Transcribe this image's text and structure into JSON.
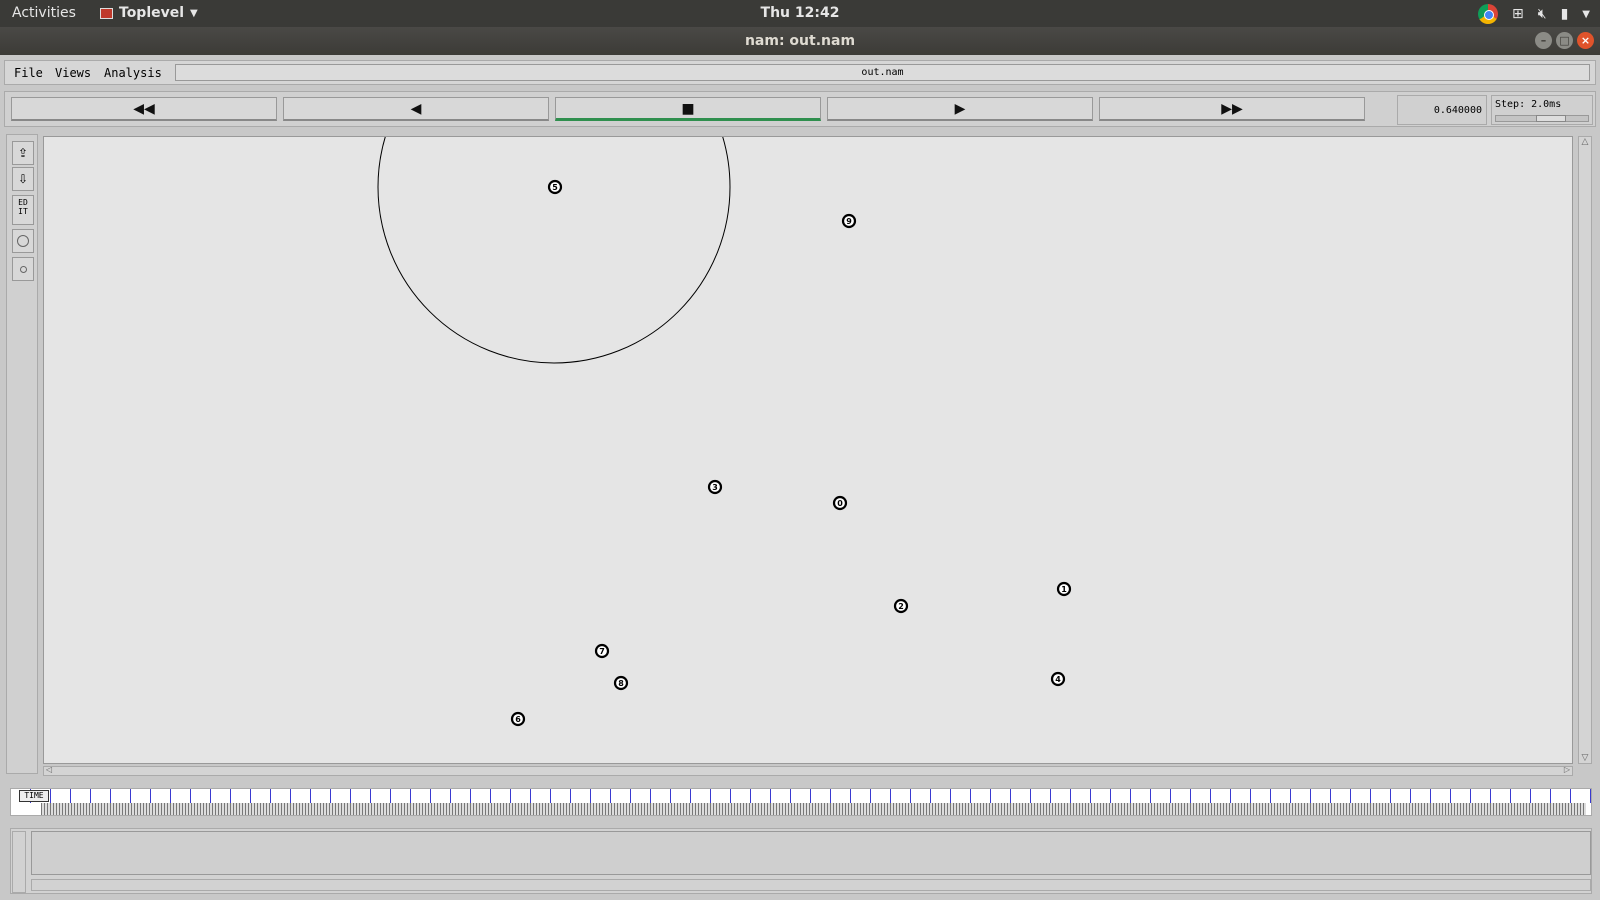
{
  "topbar": {
    "activities": "Activities",
    "app_name": "Toplevel",
    "clock": "Thu 12:42"
  },
  "window": {
    "title": "nam: out.nam"
  },
  "menubar": {
    "file": "File",
    "views": "Views",
    "analysis": "Analysis",
    "filename": "out.nam"
  },
  "controls": {
    "rewind": "◀◀",
    "back": "◀",
    "stop": "■",
    "play": "▶",
    "fastforward": "▶▶",
    "active": "stop",
    "time": "0.640000",
    "step": "Step: 2.0ms"
  },
  "tools": {
    "edit": "EDIT"
  },
  "timeslider": {
    "marker": "TIME"
  },
  "nodes": [
    {
      "id": "5"
    },
    {
      "id": "9"
    },
    {
      "id": "3"
    },
    {
      "id": "0"
    },
    {
      "id": "1"
    },
    {
      "id": "2"
    },
    {
      "id": "7"
    },
    {
      "id": "8"
    },
    {
      "id": "4"
    },
    {
      "id": "6"
    }
  ],
  "colors": {
    "active_underline": "#2f8f4e",
    "canvas_bg": "#e5e5e5",
    "close_button": "#e0532b"
  }
}
